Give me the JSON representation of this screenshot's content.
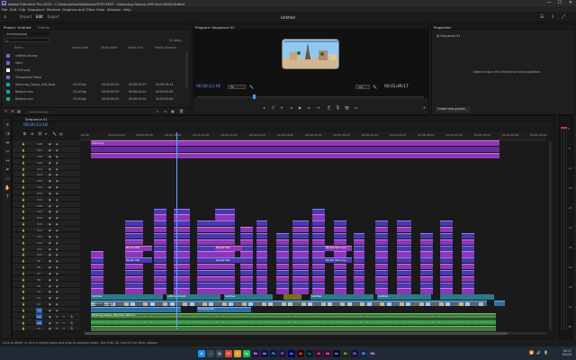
{
  "window": {
    "app_title": "Adobe Premiere Pro 2023 - C:\\Users\\shoro\\Desktop\\TEST EDIT - Samsung Galaxy A36 Dual SIM\\Untitled",
    "minimize": "—",
    "maximize": "☐",
    "close": "✕"
  },
  "menu": [
    "File",
    "Edit",
    "Clip",
    "Sequence",
    "Markers",
    "Graphics and Titles",
    "View",
    "Window",
    "Help"
  ],
  "workspaces": {
    "home_icon": "home-icon",
    "tabs": [
      "Import",
      "Edit",
      "Export"
    ],
    "active": "Edit",
    "document_title": "Untitled"
  },
  "project_panel": {
    "tab": "Project: Untitled",
    "effects_tab": "Effects",
    "search_placeholder": "",
    "folder": "Untitled.prproj",
    "item_count": "15 items",
    "columns": [
      "Name",
      "Frame Rate",
      "Media Start",
      "Media End",
      "Media Duration"
    ],
    "items": [
      {
        "name": "untitled-ok.png",
        "color": "#8a5bd8",
        "rate": "",
        "start": "",
        "end": "",
        "dur": ""
      },
      {
        "name": "Hair1",
        "color": "#8a5bd8",
        "rate": "",
        "start": "",
        "end": "",
        "dur": ""
      },
      {
        "name": "LOGO.png",
        "color": "#ffffff",
        "rate": "",
        "start": "",
        "end": "",
        "dur": ""
      },
      {
        "name": "Transparent Video",
        "color": "#8a5bd8",
        "rate": "",
        "start": "",
        "end": "",
        "dur": ""
      },
      {
        "name": "Samsung_Galaxy_A36_Dual...",
        "color": "#1aa69a",
        "rate": "25.00 fps",
        "start": "00:00:00:00",
        "end": "00:00:59:13",
        "dur": "00:00:59:14"
      },
      {
        "name": "Bedone.mov",
        "color": "#1aa69a",
        "rate": "25.00 fps",
        "start": "00:00:00:00",
        "end": "00:00:04:24",
        "dur": "00:00:05:00"
      },
      {
        "name": "Bedone.mov",
        "color": "#1aa69a",
        "rate": "25.00 fps",
        "start": "00:00:00:00",
        "end": "00:00:04:24",
        "dur": "00:00:05:00"
      }
    ]
  },
  "program_monitor": {
    "tab": "Program: Sequence 01",
    "timecode": "00;00;13;18",
    "fit": "Fit",
    "quality": "1/2",
    "duration": "00;01;49;17"
  },
  "properties": {
    "tab": "Properties",
    "sequence_name": "Sequence 01",
    "hint": "Select a clip in the Timeline to view properties.",
    "button": "Create new graphic"
  },
  "timeline": {
    "tab": "Sequence 01",
    "timecode": "00;00;13;18",
    "ruler": [
      ":00;00",
      "00;00;04;00",
      "00;00;08;00",
      "00;00;12;00",
      "00;00;16;00",
      "00;00;20;00",
      "00;00;24;00",
      "00;00;28;00",
      "00;00;32;00",
      "00;00;36;00",
      "00;00;40;00",
      "00;00;44;00",
      "00;00;48;00",
      "00;00;52;00",
      "00;00;56;00",
      "00;01;00;00",
      "00;01;04;00"
    ],
    "tracks": [
      "V28",
      "V27",
      "V26",
      "V25",
      "V24",
      "V23",
      "V22",
      "V21",
      "V20",
      "V19",
      "V18",
      "V17",
      "V16",
      "V15",
      "V14",
      "V13",
      "V12",
      "V11",
      "V10",
      "V9",
      "V8",
      "V7",
      "V6",
      "V5",
      "V4",
      "V3",
      "V2",
      "V1",
      "A1",
      "A2",
      "A3"
    ],
    "clip_labels": {
      "top": "LOGO.png",
      "review_text": "Review Text",
      "review_text_logo": "Review Text Logo...",
      "subtitles": "Subtitles",
      "caffe": "caffe blinkmath",
      "subtitles2": "Subtitles",
      "subtitles3": "Subtitles",
      "subtitles4": "Subtitles",
      "samsung": "Samsung Galaxy...",
      "samsung2": "Samsung Gal...",
      "samsung_long": "Samsung_Galaxy_A36_Dual_SIM.mov"
    }
  },
  "meter": {
    "labels": [
      "0",
      "-6",
      "-12",
      "-18",
      "-24",
      "-30",
      "-36",
      "-42",
      "-48",
      "-54",
      "dB"
    ]
  },
  "status_bar": "Click to select, or click in empty space and drag to marquee select. Use Shift, Alt, and Ctrl for other options.",
  "taskbar": {
    "apps": [
      {
        "label": "⊞",
        "color": "#1e90ff"
      },
      {
        "label": "⌕",
        "color": "#394654"
      },
      {
        "label": "▤",
        "color": "#394654"
      },
      {
        "label": "Ch",
        "color": "#e04535"
      },
      {
        "label": "Fi",
        "color": "#e0a020"
      },
      {
        "label": "Sp",
        "color": "#1db954"
      },
      {
        "label": "Me",
        "color": "#2a0a4e"
      },
      {
        "label": "Ae",
        "color": "#1a0a4e"
      },
      {
        "label": "Ps",
        "color": "#001e36"
      },
      {
        "label": "Pr",
        "color": "#2a0a4e"
      },
      {
        "label": "Au",
        "color": "#00005b"
      },
      {
        "label": "Ai",
        "color": "#330000"
      },
      {
        "label": "Lr",
        "color": "#001a2c"
      },
      {
        "label": "Id",
        "color": "#49021f"
      },
      {
        "label": "Xd",
        "color": "#470137"
      },
      {
        "label": "An",
        "color": "#000a2e"
      },
      {
        "label": "Dn",
        "color": "#1a2e00"
      },
      {
        "label": "Ch",
        "color": "#1a0a4e"
      },
      {
        "label": "Bf",
        "color": "#0a2a4e"
      },
      {
        "label": "Md",
        "color": "#30204e"
      }
    ],
    "time": "02:17",
    "date": "5/1/25"
  }
}
